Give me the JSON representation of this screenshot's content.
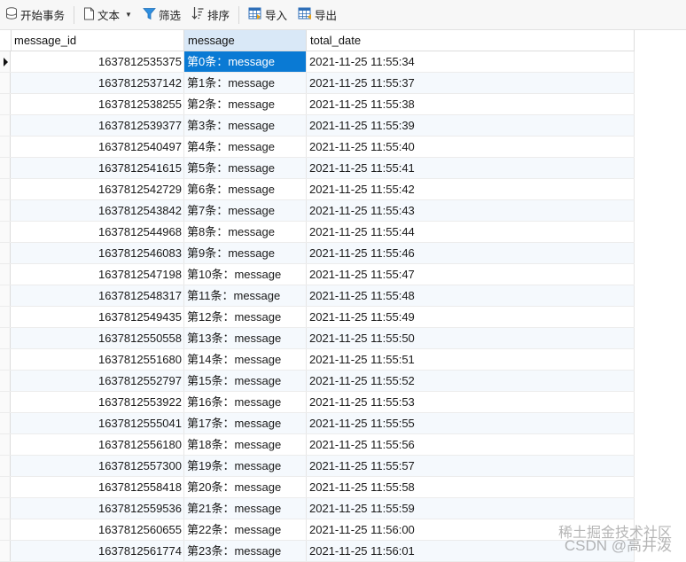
{
  "toolbar": {
    "begin_transaction": "开始事务",
    "text": "文本",
    "filter": "筛选",
    "sort": "排序",
    "import": "导入",
    "export": "导出"
  },
  "columns": [
    "message_id",
    "message",
    "total_date"
  ],
  "rows": [
    [
      "1637812535375",
      "第0条：message",
      "2021-11-25 11:55:34"
    ],
    [
      "1637812537142",
      "第1条：message",
      "2021-11-25 11:55:37"
    ],
    [
      "1637812538255",
      "第2条：message",
      "2021-11-25 11:55:38"
    ],
    [
      "1637812539377",
      "第3条：message",
      "2021-11-25 11:55:39"
    ],
    [
      "1637812540497",
      "第4条：message",
      "2021-11-25 11:55:40"
    ],
    [
      "1637812541615",
      "第5条：message",
      "2021-11-25 11:55:41"
    ],
    [
      "1637812542729",
      "第6条：message",
      "2021-11-25 11:55:42"
    ],
    [
      "1637812543842",
      "第7条：message",
      "2021-11-25 11:55:43"
    ],
    [
      "1637812544968",
      "第8条：message",
      "2021-11-25 11:55:44"
    ],
    [
      "1637812546083",
      "第9条：message",
      "2021-11-25 11:55:46"
    ],
    [
      "1637812547198",
      "第10条：message",
      "2021-11-25 11:55:47"
    ],
    [
      "1637812548317",
      "第11条：message",
      "2021-11-25 11:55:48"
    ],
    [
      "1637812549435",
      "第12条：message",
      "2021-11-25 11:55:49"
    ],
    [
      "1637812550558",
      "第13条：message",
      "2021-11-25 11:55:50"
    ],
    [
      "1637812551680",
      "第14条：message",
      "2021-11-25 11:55:51"
    ],
    [
      "1637812552797",
      "第15条：message",
      "2021-11-25 11:55:52"
    ],
    [
      "1637812553922",
      "第16条：message",
      "2021-11-25 11:55:53"
    ],
    [
      "1637812555041",
      "第17条：message",
      "2021-11-25 11:55:55"
    ],
    [
      "1637812556180",
      "第18条：message",
      "2021-11-25 11:55:56"
    ],
    [
      "1637812557300",
      "第19条：message",
      "2021-11-25 11:55:57"
    ],
    [
      "1637812558418",
      "第20条：message",
      "2021-11-25 11:55:58"
    ],
    [
      "1637812559536",
      "第21条：message",
      "2021-11-25 11:55:59"
    ],
    [
      "1637812560655",
      "第22条：message",
      "2021-11-25 11:56:00"
    ],
    [
      "1637812561774",
      "第23条：message",
      "2021-11-25 11:56:01"
    ]
  ],
  "watermark": {
    "line1": "稀土掘金技术社区",
    "line2": "CSDN @高井泼"
  },
  "colors": {
    "selected_cell": "#0a7ad4",
    "selected_header": "#d9e8f7",
    "filter_icon": "#2f8fe0",
    "grid_icon": "#2f6fb8"
  }
}
